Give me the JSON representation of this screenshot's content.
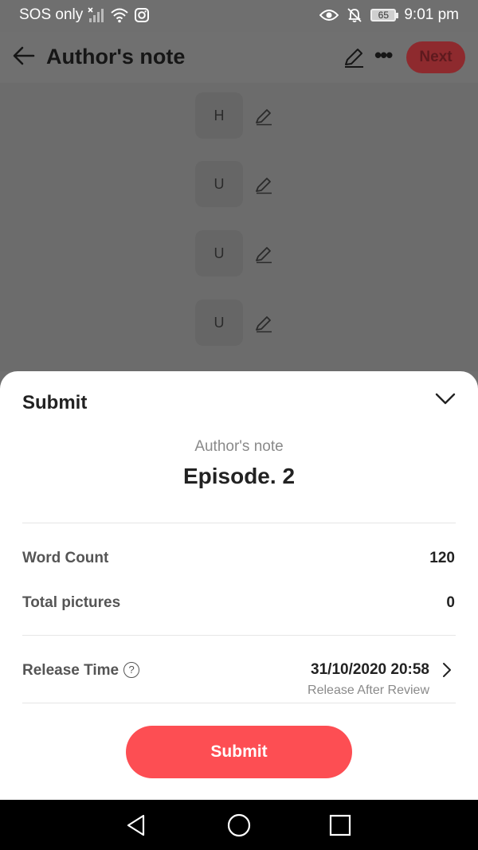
{
  "status_bar": {
    "carrier": "SOS only",
    "battery": "65",
    "time": "9:01 pm"
  },
  "header": {
    "title": "Author's note",
    "next_label": "Next"
  },
  "chapters": [
    {
      "initial": "H"
    },
    {
      "initial": "U"
    },
    {
      "initial": "U"
    },
    {
      "initial": "U"
    }
  ],
  "sheet": {
    "title": "Submit",
    "subtitle": "Author's note",
    "episode": "Episode. 2",
    "word_count_label": "Word Count",
    "word_count_value": "120",
    "pictures_label": "Total pictures",
    "pictures_value": "0",
    "release_label": "Release Time",
    "release_help": "?",
    "release_value": "31/10/2020 20:58",
    "release_sub": "Release After Review",
    "submit_label": "Submit"
  },
  "colors": {
    "accent": "#fd4e53",
    "overlay": "#6f6f6f"
  }
}
